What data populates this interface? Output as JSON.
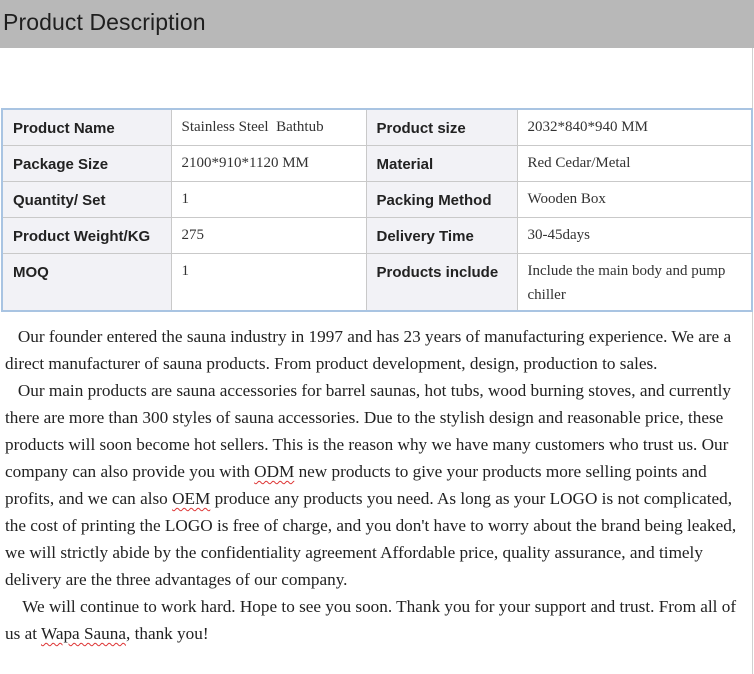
{
  "header": {
    "title": "Product Description"
  },
  "spec_table": {
    "rows": [
      {
        "label1": "Product Name",
        "value1": "Stainless Steel  Bathtub",
        "label2": "Product size",
        "value2": "2032*840*940 MM"
      },
      {
        "label1": "Package Size",
        "value1": "2100*910*1120 MM",
        "label2": "Material",
        "value2": "Red Cedar/Metal"
      },
      {
        "label1": "Quantity/ Set",
        "value1": "1",
        "label2": "Packing Method",
        "value2": "Wooden Box"
      },
      {
        "label1": "Product Weight/KG",
        "value1": "275",
        "label2": "Delivery Time",
        "value2": "30-45days"
      },
      {
        "label1": "MOQ",
        "value1": "1",
        "label2": "Products include",
        "value2": "Include the main body and pump chiller"
      }
    ]
  },
  "description": {
    "p1": "Our founder entered the sauna industry in 1997 and has 23 years of manufacturing experience. We are a direct manufacturer of sauna products. From product development, design, production to sales.",
    "p2_part1": "Our main products are sauna accessories for barrel saunas, hot tubs, wood burning stoves, and currently there are more than 300 styles of sauna accessories. Due to the stylish design and reasonable price, these products will soon become hot sellers. This is the reason why we have many customers who trust us. Our company can also provide you with ",
    "p2_odm": "ODM",
    "p2_part2": " new products to give your products more selling points and profits, and we can also ",
    "p2_oem": "OEM",
    "p2_part3": " produce any products you need. As long as your LOGO is not complicated, the cost of printing the LOGO is free of charge, and you don't have to worry about the brand being leaked, we will strictly abide by the confidentiality agreement Affordable price, quality assurance, and timely delivery are the three advantages of our company.",
    "p3_part1": "We will continue to work hard. Hope to see you soon. Thank you for your support and trust. From all of us at ",
    "p3_brand": "Wapa Sauna",
    "p3_part2": ", thank you!"
  }
}
